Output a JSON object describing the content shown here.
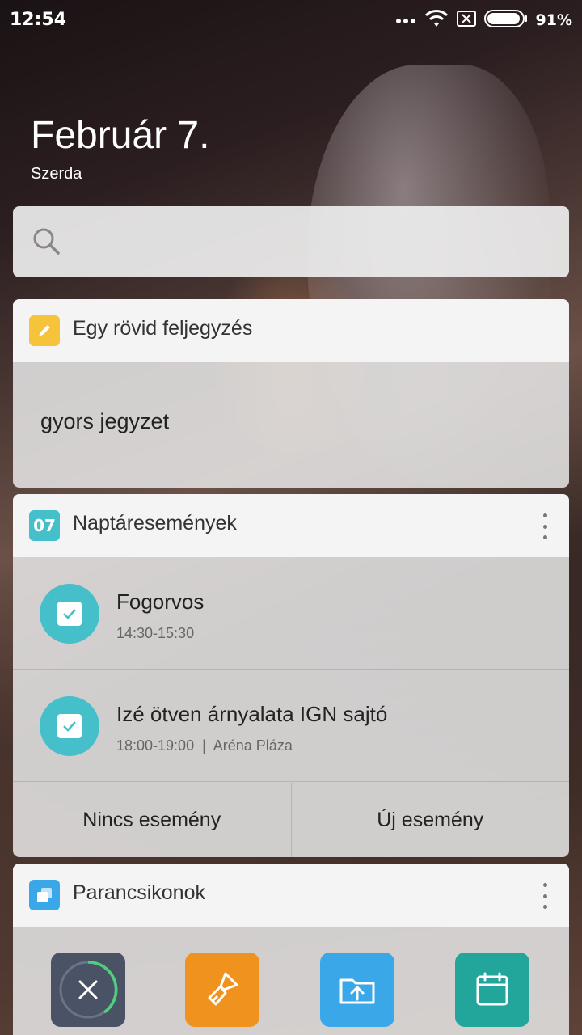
{
  "status_bar": {
    "time": "12:54",
    "battery_pct": "91%"
  },
  "header": {
    "date": "Február 7.",
    "weekday": "Szerda"
  },
  "search": {
    "placeholder": ""
  },
  "note_card": {
    "title": "Egy rövid feljegyzés",
    "body": "gyors jegyzet",
    "icon": "pencil-icon",
    "icon_color": "#f6c43a"
  },
  "calendar_card": {
    "title": "Naptáresemények",
    "icon_text": "07",
    "icon_color": "#45bfc9",
    "events": [
      {
        "title": "Fogorvos",
        "time": "14:30-15:30"
      },
      {
        "title": "Izé ötven árnyalata IGN sajtó",
        "time": "18:00-19:00  |  Aréna Pláza"
      }
    ],
    "actions": {
      "left": "Nincs esemény",
      "right": "Új esemény"
    }
  },
  "shortcuts_card": {
    "title": "Parancsikonok",
    "icon_color": "#3aa7e8",
    "items": [
      {
        "icon": "clean-close-icon",
        "color": "#4a5266"
      },
      {
        "icon": "brush-icon",
        "color": "#f0921e"
      },
      {
        "icon": "upload-folder-icon",
        "color": "#3aa7e8"
      },
      {
        "icon": "calendar-icon",
        "color": "#22a59a"
      }
    ]
  }
}
